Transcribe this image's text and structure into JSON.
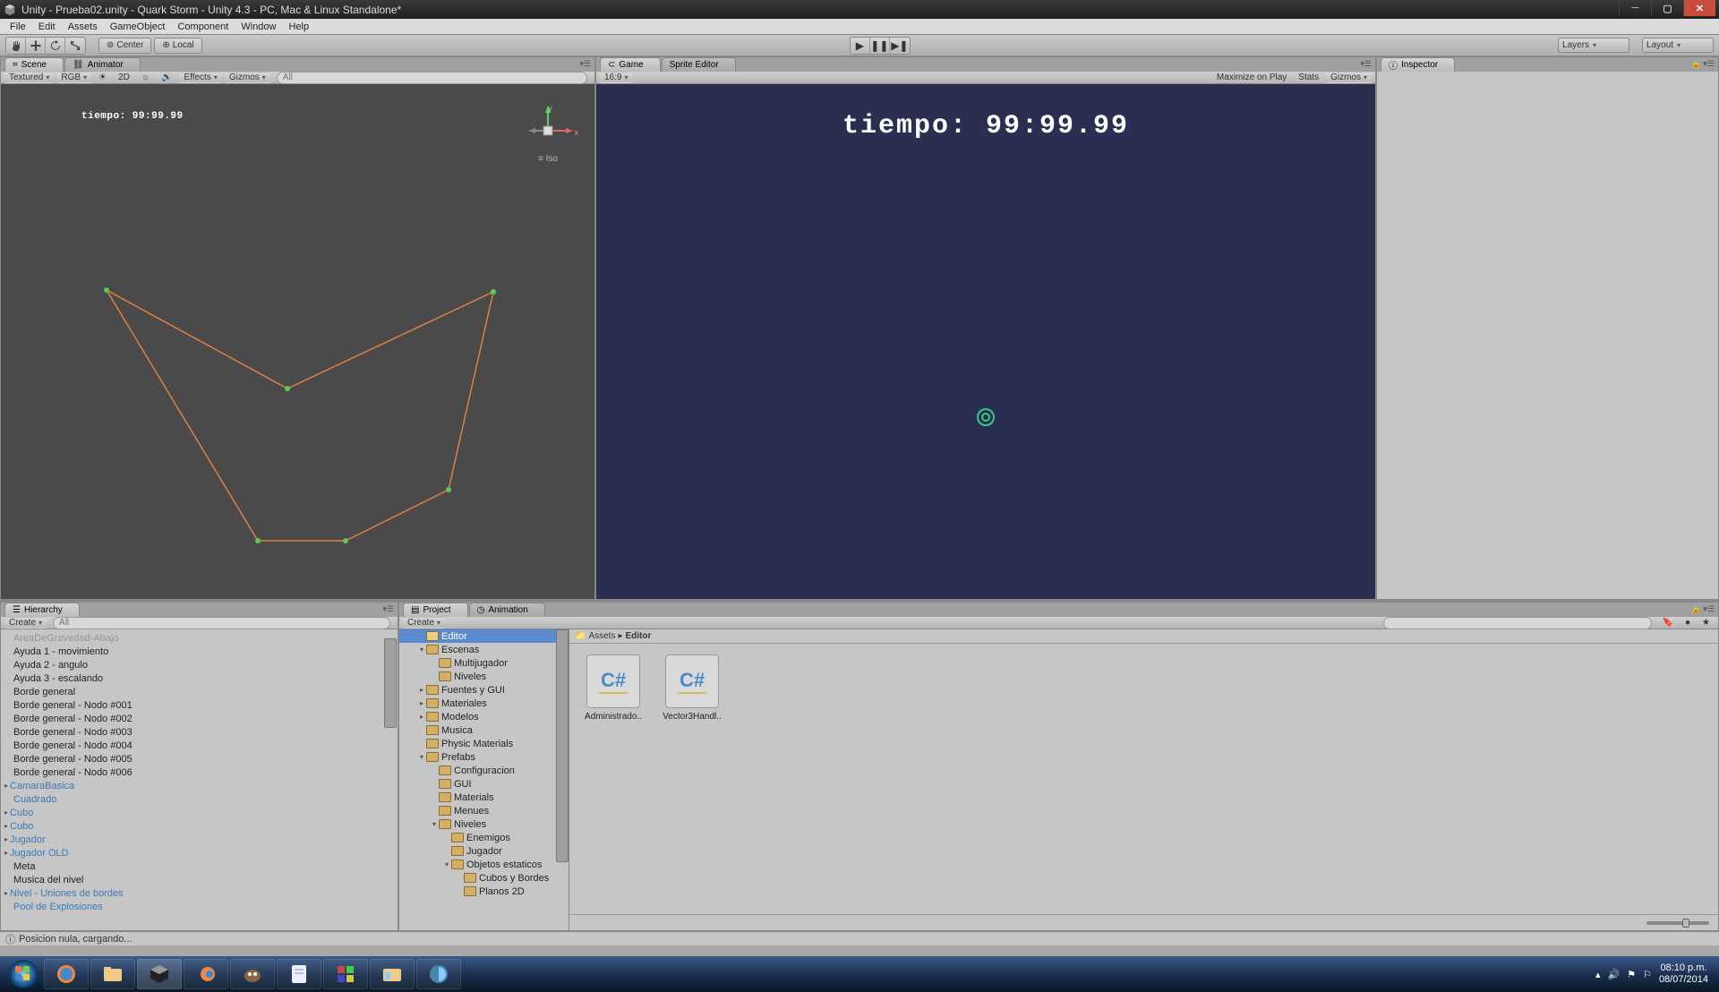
{
  "window": {
    "title": "Unity - Prueba02.unity - Quark Storm - Unity 4.3 - PC, Mac & Linux Standalone*"
  },
  "menus": [
    "File",
    "Edit",
    "Assets",
    "GameObject",
    "Component",
    "Window",
    "Help"
  ],
  "toolbar": {
    "center": "Center",
    "local": "Local",
    "layers": "Layers",
    "layout": "Layout"
  },
  "scene_tab": "Scene",
  "animator_tab": "Animator",
  "game_tab": "Game",
  "sprite_tab": "Sprite Editor",
  "inspector_tab": "Inspector",
  "scene_opts": {
    "render": "Textured",
    "rgb": "RGB",
    "twod": "2D",
    "effects": "Effects",
    "gizmos": "Gizmos",
    "search_ph": "All"
  },
  "scene_axis": {
    "x": "x",
    "y": "y",
    "iso": "Iso"
  },
  "scene_overlay": "tiempo:  99:99.99",
  "game_opts": {
    "aspect": "16:9",
    "maximize": "Maximize on Play",
    "stats": "Stats",
    "gizmos": "Gizmos"
  },
  "game_overlay": "tiempo:  99:99.99",
  "hierarchy_tab": "Hierarchy",
  "hierarchy_create": "Create",
  "hierarchy_search_ph": "All",
  "hierarchy": [
    {
      "label": "AreaDeGravedad-Abajo",
      "style": "dim",
      "exp": false
    },
    {
      "label": "Ayuda 1 - movimiento",
      "style": "",
      "exp": false
    },
    {
      "label": "Ayuda 2 - angulo",
      "style": "",
      "exp": false
    },
    {
      "label": "Ayuda 3 - escalando",
      "style": "",
      "exp": false
    },
    {
      "label": "Borde general",
      "style": "",
      "exp": false
    },
    {
      "label": "Borde general - Nodo #001",
      "style": "",
      "exp": false
    },
    {
      "label": "Borde general - Nodo #002",
      "style": "",
      "exp": false
    },
    {
      "label": "Borde general - Nodo #003",
      "style": "",
      "exp": false
    },
    {
      "label": "Borde general - Nodo #004",
      "style": "",
      "exp": false
    },
    {
      "label": "Borde general - Nodo #005",
      "style": "",
      "exp": false
    },
    {
      "label": "Borde general - Nodo #006",
      "style": "",
      "exp": false
    },
    {
      "label": "CamaraBasica",
      "style": "blue",
      "exp": true
    },
    {
      "label": "Cuadrado",
      "style": "blue",
      "exp": false
    },
    {
      "label": "Cubo",
      "style": "blue",
      "exp": true
    },
    {
      "label": "Cubo",
      "style": "blue",
      "exp": true
    },
    {
      "label": "Jugador",
      "style": "blue",
      "exp": true
    },
    {
      "label": "Jugador OLD",
      "style": "blue",
      "exp": true
    },
    {
      "label": "Meta",
      "style": "",
      "exp": false
    },
    {
      "label": "Musica del nivel",
      "style": "",
      "exp": false
    },
    {
      "label": "Nivel - Uniones de bordes",
      "style": "blue",
      "exp": true
    },
    {
      "label": "Pool de Explosiones",
      "style": "blue",
      "exp": false
    }
  ],
  "project_tab": "Project",
  "animation_tab": "Animation",
  "project_create": "Create",
  "tree": [
    {
      "label": "Editor",
      "depth": 1,
      "sel": true,
      "arrow": ""
    },
    {
      "label": "Escenas",
      "depth": 1,
      "arrow": "open"
    },
    {
      "label": "Multijugador",
      "depth": 2,
      "arrow": ""
    },
    {
      "label": "Niveles",
      "depth": 2,
      "arrow": ""
    },
    {
      "label": "Fuentes y GUI",
      "depth": 1,
      "arrow": "closed"
    },
    {
      "label": "Materiales",
      "depth": 1,
      "arrow": "closed"
    },
    {
      "label": "Modelos",
      "depth": 1,
      "arrow": "closed"
    },
    {
      "label": "Musica",
      "depth": 1,
      "arrow": ""
    },
    {
      "label": "Physic Materials",
      "depth": 1,
      "arrow": ""
    },
    {
      "label": "Prefabs",
      "depth": 1,
      "arrow": "open"
    },
    {
      "label": "Configuracion",
      "depth": 2,
      "arrow": ""
    },
    {
      "label": "GUI",
      "depth": 2,
      "arrow": ""
    },
    {
      "label": "Materials",
      "depth": 2,
      "arrow": ""
    },
    {
      "label": "Menues",
      "depth": 2,
      "arrow": ""
    },
    {
      "label": "Niveles",
      "depth": 2,
      "arrow": "open"
    },
    {
      "label": "Enemigos",
      "depth": 3,
      "arrow": ""
    },
    {
      "label": "Jugador",
      "depth": 3,
      "arrow": ""
    },
    {
      "label": "Objetos estaticos",
      "depth": 3,
      "arrow": "open"
    },
    {
      "label": "Cubos y Bordes",
      "depth": 4,
      "arrow": ""
    },
    {
      "label": "Planos 2D",
      "depth": 4,
      "arrow": ""
    }
  ],
  "breadcrumb": {
    "root": "Assets",
    "sep": "▸",
    "cur": "Editor"
  },
  "assets": [
    {
      "label": "Administrado..",
      "type": "cs"
    },
    {
      "label": "Vector3Handl..",
      "type": "cs"
    }
  ],
  "status": "Posicion nula, cargando...",
  "systray": {
    "time": "08:10 p.m.",
    "date": "08/07/2014"
  }
}
